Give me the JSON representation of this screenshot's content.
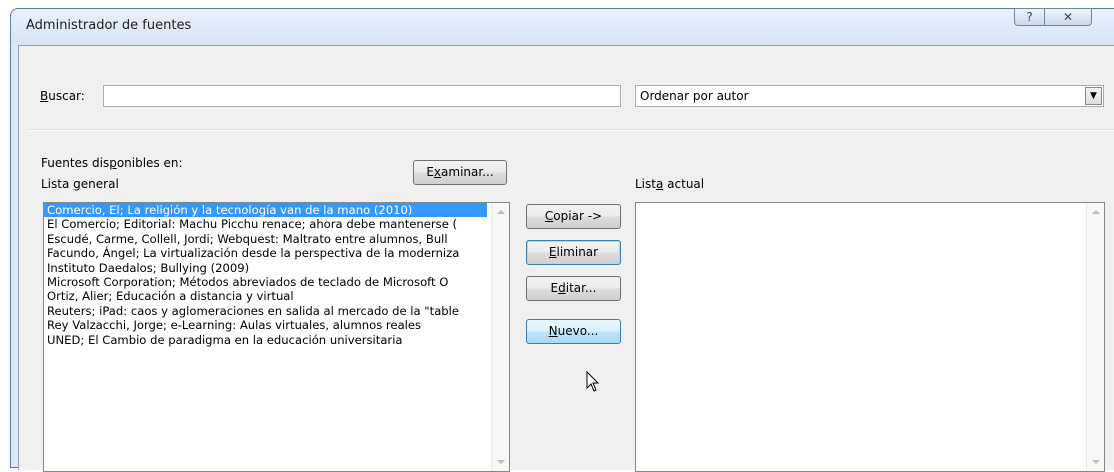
{
  "window": {
    "title": "Administrador de fuentes",
    "help_glyph": "?",
    "close_glyph": "✕"
  },
  "search": {
    "label_underlined": "B",
    "label_rest": "uscar:",
    "value": ""
  },
  "sort": {
    "selected": "Ordenar por autor",
    "arrow_glyph": "▼"
  },
  "sources": {
    "available_pre": "Fuentes dis",
    "available_u": "p",
    "available_post": "onibles en:",
    "general_pre": "Lista ",
    "general_u": "g",
    "general_post": "eneral",
    "current_pre": "List",
    "current_u": "a",
    "current_post": " actual"
  },
  "buttons": {
    "examinar_pre": "E",
    "examinar_u": "x",
    "examinar_post": "aminar...",
    "copy_u": "C",
    "copy_post": "opiar ->",
    "delete_u": "E",
    "delete_post": "liminar",
    "edit_pre": "E",
    "edit_u": "d",
    "edit_post": "itar...",
    "new_u": "N",
    "new_post": "uevo..."
  },
  "general_list": [
    "Comercio, El; La religión y la tecnología van de la mano (2010)",
    "El Comercio; Editorial: Machu Picchu renace; ahora debe mantenerse (",
    "Escudé, Carme, Collell, Jordi; Webquest: Maltrato entre alumnos, Bull",
    "Facundo, Ángel; La virtualización desde la perspectiva de la moderniza",
    "Instituto Daedalos; Bullying (2009)",
    "Microsoft Corporation; Métodos abreviados de teclado de Microsoft O",
    "Ortiz, Alier; Educación a distancia y virtual",
    "Reuters; iPad: caos y aglomeraciones en salida al mercado de la \"table",
    "Rey Valzacchi, Jorge; e-Learning: Aulas virtuales, alumnos reales",
    "UNED; El Cambio de paradigma en la educación universitaria"
  ],
  "current_list": []
}
